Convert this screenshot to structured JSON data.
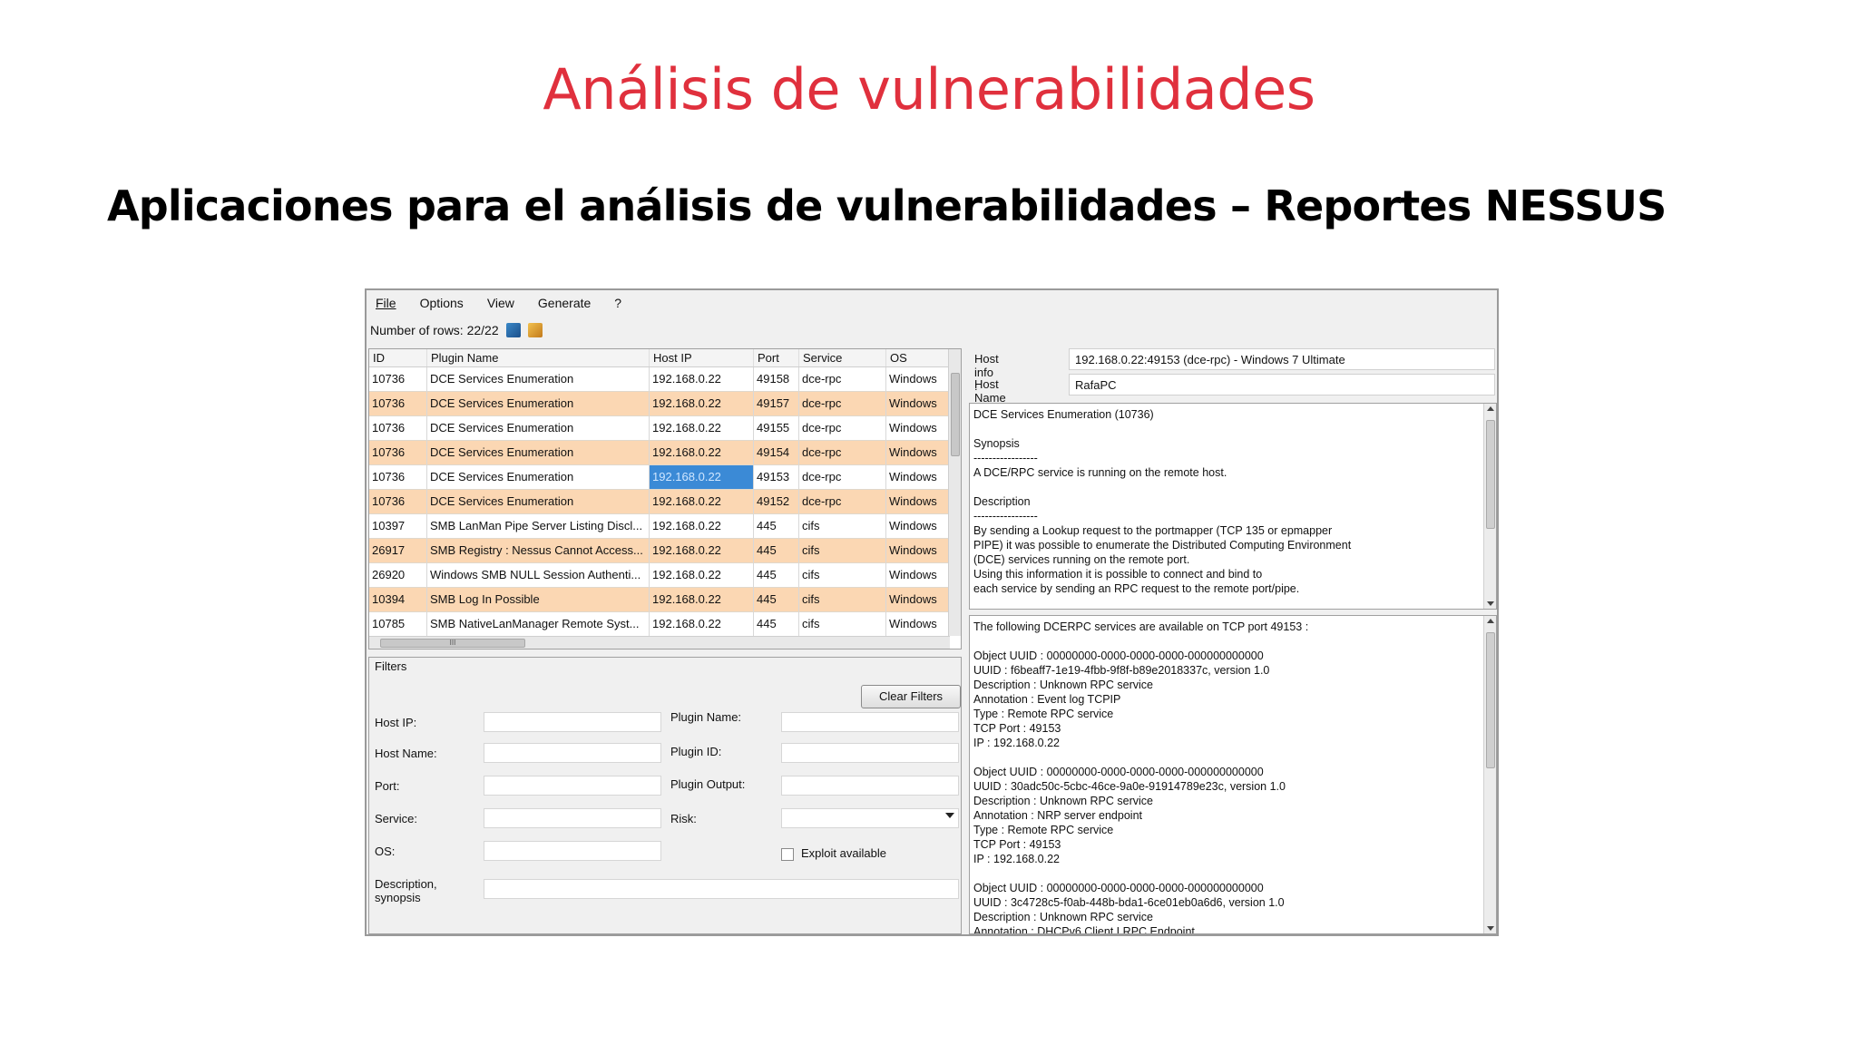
{
  "slide": {
    "title": "Análisis de vulnerabilidades",
    "subtitle": "Aplicaciones para el análisis de vulnerabilidades – Reportes NESSUS"
  },
  "menu": [
    "File",
    "Options",
    "View",
    "Generate",
    "?"
  ],
  "toolbar": {
    "rows_label": "Number of rows: 22/22",
    "icons": [
      "export-icon",
      "clean-icon"
    ]
  },
  "grid": {
    "columns": [
      "ID",
      "Plugin Name",
      "Host IP",
      "Port",
      "Service",
      "OS"
    ],
    "rows": [
      [
        "10736",
        "DCE Services Enumeration",
        "192.168.0.22",
        "49158",
        "dce-rpc",
        "Windows"
      ],
      [
        "10736",
        "DCE Services Enumeration",
        "192.168.0.22",
        "49157",
        "dce-rpc",
        "Windows"
      ],
      [
        "10736",
        "DCE Services Enumeration",
        "192.168.0.22",
        "49155",
        "dce-rpc",
        "Windows"
      ],
      [
        "10736",
        "DCE Services Enumeration",
        "192.168.0.22",
        "49154",
        "dce-rpc",
        "Windows"
      ],
      [
        "10736",
        "DCE Services Enumeration",
        "192.168.0.22",
        "49153",
        "dce-rpc",
        "Windows"
      ],
      [
        "10736",
        "DCE Services Enumeration",
        "192.168.0.22",
        "49152",
        "dce-rpc",
        "Windows"
      ],
      [
        "10397",
        "SMB LanMan Pipe Server Listing Discl...",
        "192.168.0.22",
        "445",
        "cifs",
        "Windows"
      ],
      [
        "26917",
        "SMB Registry : Nessus Cannot Access...",
        "192.168.0.22",
        "445",
        "cifs",
        "Windows"
      ],
      [
        "26920",
        "Windows SMB NULL Session Authenti...",
        "192.168.0.22",
        "445",
        "cifs",
        "Windows"
      ],
      [
        "10394",
        "SMB Log In Possible",
        "192.168.0.22",
        "445",
        "cifs",
        "Windows"
      ],
      [
        "10785",
        "SMB NativeLanManager Remote Syst...",
        "192.168.0.22",
        "445",
        "cifs",
        "Windows"
      ]
    ],
    "hscroll_glyph": "III"
  },
  "filters": {
    "label": "Filters",
    "clear_button": "Clear Filters",
    "left_labels": [
      "Host IP:",
      "Host Name:",
      "Port:",
      "Service:",
      "OS:",
      "Description, synopsis"
    ],
    "right_labels": [
      "Plugin Name:",
      "Plugin ID:",
      "Plugin Output:",
      "Risk:"
    ],
    "exploit_label": "Exploit available"
  },
  "details": {
    "host_info_label": "Host info :",
    "host_info_value": "192.168.0.22:49153 (dce-rpc) - Windows 7 Ultimate",
    "host_name_label": "Host Name :",
    "host_name_value": "RafaPC",
    "description_lines": [
      "DCE Services Enumeration (10736)",
      "",
      "Synopsis",
      "-----------------",
      "A DCE/RPC service is running on the remote host.",
      "",
      "Description",
      "-----------------",
      "By sending a Lookup request to the portmapper (TCP 135 or epmapper",
      "PIPE) it was possible to enumerate the Distributed Computing Environment",
      "(DCE) services running on the remote port.",
      "Using this information it is possible to connect and bind to",
      "each service by sending an RPC request to the remote port/pipe."
    ],
    "output_lines": [
      "The following DCERPC services are available on TCP port 49153 :",
      "",
      "Object UUID : 00000000-0000-0000-0000-000000000000",
      "UUID : f6beaff7-1e19-4fbb-9f8f-b89e2018337c, version 1.0",
      "Description : Unknown RPC service",
      "Annotation : Event log TCPIP",
      "Type : Remote RPC service",
      "TCP Port : 49153",
      "IP : 192.168.0.22",
      "",
      "Object UUID : 00000000-0000-0000-0000-000000000000",
      "UUID : 30adc50c-5cbc-46ce-9a0e-91914789e23c, version 1.0",
      "Description : Unknown RPC service",
      "Annotation : NRP server endpoint",
      "Type : Remote RPC service",
      "TCP Port : 49153",
      "IP : 192.168.0.22",
      "",
      "Object UUID : 00000000-0000-0000-0000-000000000000",
      "UUID : 3c4728c5-f0ab-448b-bda1-6ce01eb0a6d6, version 1.0",
      "Description : Unknown RPC service",
      "Annotation : DHCPv6 Client LRPC Endpoint"
    ]
  }
}
